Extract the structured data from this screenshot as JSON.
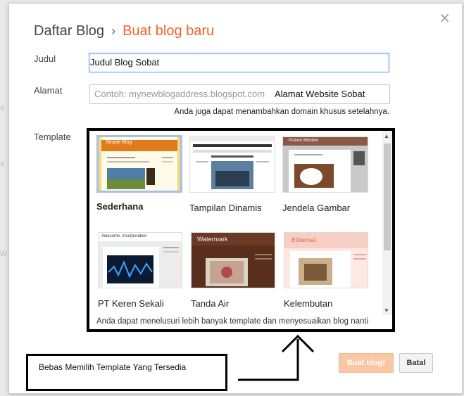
{
  "dialog": {
    "breadcrumb_root": "Daftar Blog",
    "breadcrumb_separator": "›",
    "breadcrumb_current": "Buat blog baru",
    "close_glyph": "×"
  },
  "fields": {
    "title_label": "Judul",
    "title_value": "Judul Blog Sobat",
    "address_label": "Alamat",
    "address_placeholder": "Contoh: mynewblogaddress.blogspot.com",
    "address_annotation": "Alamat Website Sobat",
    "domain_hint": "Anda juga dapat menambahkan domain khusus setelahnya.",
    "template_label": "Template"
  },
  "templates": [
    {
      "name": "Sederhana",
      "thumb_title": "Simple Blog",
      "selected": true
    },
    {
      "name": "Tampilan Dinamis",
      "thumb_title": "",
      "selected": false
    },
    {
      "name": "Jendela Gambar",
      "thumb_title": "Picture Window",
      "selected": false
    },
    {
      "name": "PT Keren Sekali",
      "thumb_title": "Awesome, Incorporation",
      "selected": false
    },
    {
      "name": "Tanda Air",
      "thumb_title": "Watermark",
      "selected": false
    },
    {
      "name": "Kelembutan",
      "thumb_title": "Ethereal",
      "selected": false
    }
  ],
  "template_footer": "Anda dapat menelusuri lebih banyak template dan menyesuaikan blog nanti",
  "callout": "Bebas Memilih Template Yang Tersedia",
  "buttons": {
    "create": "Buat blog!",
    "cancel": "Batal"
  },
  "colors": {
    "accent": "#f0622c",
    "focus_border": "#4d90fe",
    "create_button": "#f9c7a4",
    "selected_thumb_border": "#a6c1e6"
  }
}
